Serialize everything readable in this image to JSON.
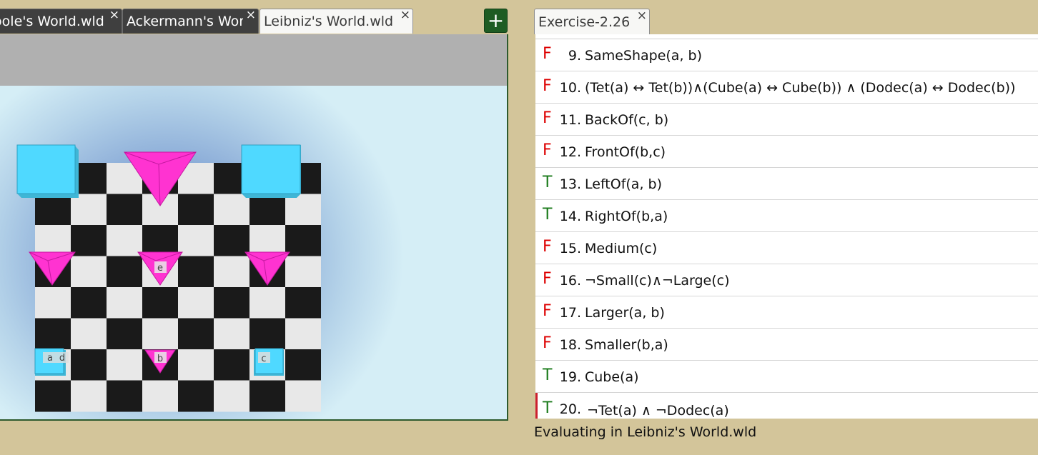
{
  "world_tabs": [
    {
      "label": "Boole's World.wld",
      "active": false
    },
    {
      "label": "Ackermann's World.wld",
      "active": false
    },
    {
      "label": "Leibniz's World.wld",
      "active": true
    }
  ],
  "close_glyph": "×",
  "add_tab_glyph": "+",
  "board": {
    "colors": {
      "dark_square": "#1a1a1a",
      "light_square": "#e8e8e8",
      "cube": "#4fd9ff",
      "tet": "#ff33d1"
    },
    "labels": {
      "a": "a",
      "b": "b",
      "c": "c",
      "d": "d",
      "e": "e"
    }
  },
  "exercise": {
    "tab_label": "Exercise-2.26",
    "sentences": [
      {
        "truth": "F",
        "number": "9.",
        "formula": "SameShape(a, b)"
      },
      {
        "truth": "F",
        "number": "10.",
        "formula": "(Tet(a) ↔ Tet(b))∧(Cube(a) ↔ Cube(b)) ∧ (Dodec(a) ↔ Dodec(b))"
      },
      {
        "truth": "F",
        "number": "11.",
        "formula": "BackOf(c, b)"
      },
      {
        "truth": "F",
        "number": "12.",
        "formula": "FrontOf(b,c)"
      },
      {
        "truth": "T",
        "number": "13.",
        "formula": "LeftOf(a, b)"
      },
      {
        "truth": "T",
        "number": "14.",
        "formula": "RightOf(b,a)"
      },
      {
        "truth": "F",
        "number": "15.",
        "formula": "Medium(c)"
      },
      {
        "truth": "F",
        "number": "16.",
        "formula": "¬Small(c)∧¬Large(c)"
      },
      {
        "truth": "F",
        "number": "17.",
        "formula": "Larger(a, b)"
      },
      {
        "truth": "F",
        "number": "18.",
        "formula": "Smaller(b,a)"
      },
      {
        "truth": "T",
        "number": "19.",
        "formula": "Cube(a)"
      },
      {
        "truth": "T",
        "number": "20.",
        "formula": "¬Tet(a) ∧ ¬Dodec(a)",
        "selected": true
      }
    ]
  },
  "status": "Evaluating in Leibniz's World.wld"
}
